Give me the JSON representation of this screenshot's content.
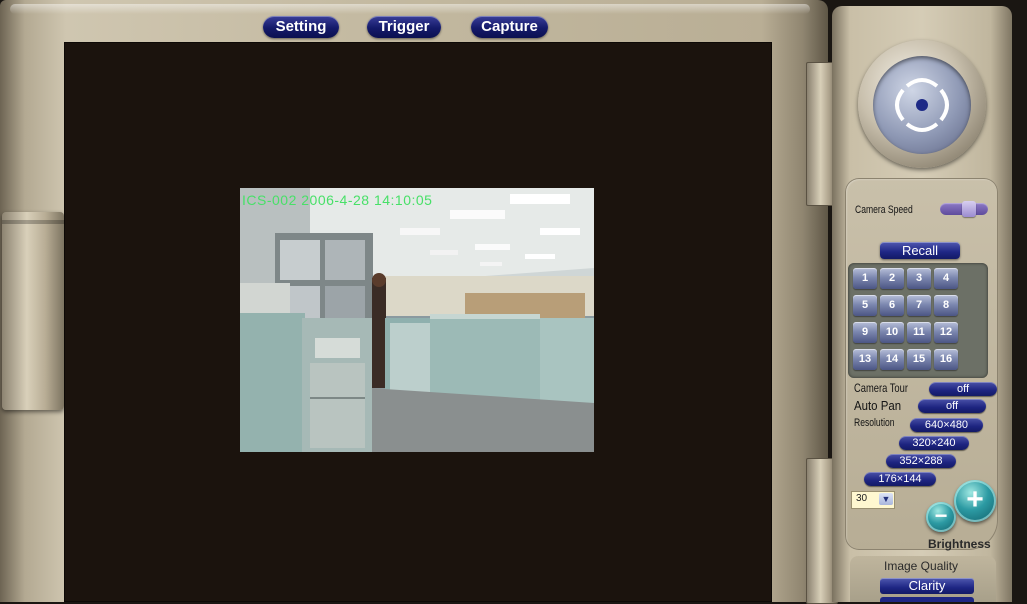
{
  "toolbar": {
    "setting_label": "Setting",
    "trigger_label": "Trigger",
    "capture_label": "Capture"
  },
  "video": {
    "overlay_text": "ICS-002  2006-4-28 14:10:05"
  },
  "panel": {
    "camera_speed_label": "Camera Speed",
    "recall_label": "Recall",
    "presets": [
      "1",
      "2",
      "3",
      "4",
      "5",
      "6",
      "7",
      "8",
      "9",
      "10",
      "11",
      "12",
      "13",
      "14",
      "15",
      "16"
    ],
    "camera_tour_label": "Camera Tour",
    "camera_tour_value": "off",
    "auto_pan_label": "Auto Pan",
    "auto_pan_value": "off",
    "resolution_label": "Resolution",
    "resolutions": [
      "640×480",
      "320×240",
      "352×288",
      "176×144"
    ],
    "fps_value": "30",
    "brightness_label": "Brightness",
    "image_quality_label": "Image Quality",
    "clarity_label": "Clarity"
  },
  "colors": {
    "button_navy": "#141a6a",
    "overlay_green": "#48e068",
    "frame_beige": "#c8bea6"
  }
}
